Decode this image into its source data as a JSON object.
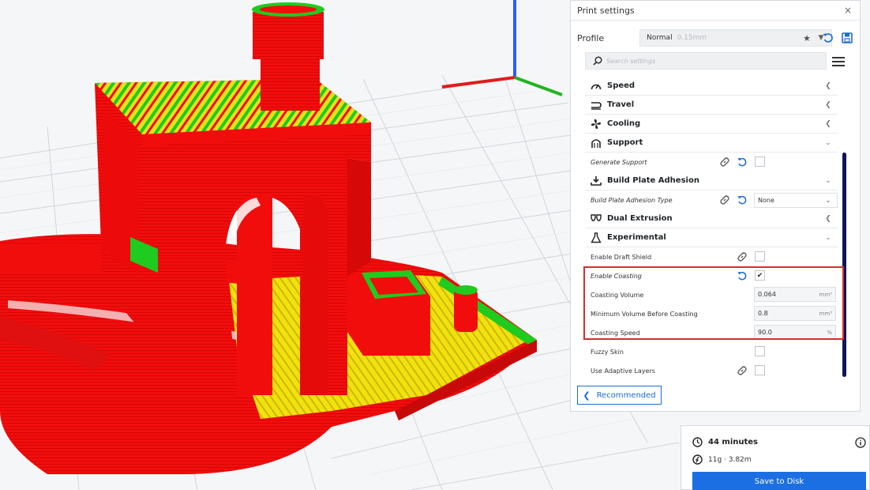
{
  "panel": {
    "title": "Print settings",
    "close_label": "×",
    "profile_label": "Profile",
    "profile_value": "Normal",
    "profile_sub": "0.15mm",
    "search_placeholder": "Search settings"
  },
  "categories": {
    "speed": "Speed",
    "travel": "Travel",
    "cooling": "Cooling",
    "support": "Support",
    "adhesion": "Build Plate Adhesion",
    "dual": "Dual Extrusion",
    "experimental": "Experimental"
  },
  "settings": {
    "generate_support": "Generate Support",
    "adhesion_type": "Build Plate Adhesion Type",
    "adhesion_type_value": "None",
    "draft_shield": "Enable Draft Shield",
    "coasting": "Enable Coasting",
    "coasting_checked": "✔",
    "coasting_volume": "Coasting Volume",
    "coasting_volume_value": "0.064",
    "coasting_volume_unit": "mm³",
    "min_volume": "Minimum Volume Before Coasting",
    "min_volume_value": "0.8",
    "min_volume_unit": "mm³",
    "coasting_speed": "Coasting Speed",
    "coasting_speed_value": "90.0",
    "coasting_speed_unit": "%",
    "fuzzy_skin": "Fuzzy Skin",
    "adaptive_layers": "Use Adaptive Layers"
  },
  "buttons": {
    "recommended": "Recommended",
    "save_to_disk": "Save to Disk"
  },
  "estimate": {
    "time": "44 minutes",
    "material": "11g · 3.82m"
  },
  "colors": {
    "accent": "#1c6fe2",
    "highlight": "#d32f2f",
    "model": "#f20d0d",
    "infill_green": "#1ecb1e",
    "infill_yellow": "#e6e61a",
    "scrollbar": "#11135a"
  }
}
